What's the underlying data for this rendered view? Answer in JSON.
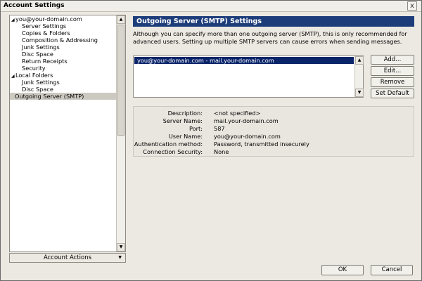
{
  "window": {
    "title": "Account Settings",
    "close_glyph": "x"
  },
  "tree": {
    "items": [
      {
        "label": "you@your-domain.com",
        "level": 0,
        "expanded": true
      },
      {
        "label": "Server Settings",
        "level": 1
      },
      {
        "label": "Copies & Folders",
        "level": 1
      },
      {
        "label": "Composition & Addressing",
        "level": 1
      },
      {
        "label": "Junk Settings",
        "level": 1
      },
      {
        "label": "Disc Space",
        "level": 1
      },
      {
        "label": "Return Receipts",
        "level": 1
      },
      {
        "label": "Security",
        "level": 1
      },
      {
        "label": "Local Folders",
        "level": 0,
        "expanded": true
      },
      {
        "label": "Junk Settings",
        "level": 1
      },
      {
        "label": "Disc Space",
        "level": 1
      },
      {
        "label": "Outgoing Server (SMTP)",
        "level": 0,
        "selected": true
      }
    ]
  },
  "account_actions": {
    "label": "Account Actions"
  },
  "main": {
    "heading": "Outgoing Server (SMTP) Settings",
    "description": "Although you can specify more than one outgoing server (SMTP), this is only recommended for advanced users. Setting up multiple SMTP servers can cause errors when sending messages.",
    "server_list": [
      "you@your-domain.com - mail.your-domain.com"
    ],
    "buttons": {
      "add": "Add...",
      "edit": "Edit...",
      "remove": "Remove",
      "set_default": "Set Default"
    },
    "details": {
      "description_label": "Description:",
      "description_value": "<not specified>",
      "server_name_label": "Server Name:",
      "server_name_value": "mail.your-domain.com",
      "port_label": "Port:",
      "port_value": "587",
      "user_name_label": "User Name:",
      "user_name_value": "you@your-domain.com",
      "auth_label": "Authentication method:",
      "auth_value": "Password, transmitted insecurely",
      "security_label": "Connection Security:",
      "security_value": "None"
    }
  },
  "footer": {
    "ok": "OK",
    "cancel": "Cancel"
  },
  "colors": {
    "header_bg": "#1d3d7a",
    "selection_bg": "#0a246a",
    "window_bg": "#ece9e2"
  }
}
